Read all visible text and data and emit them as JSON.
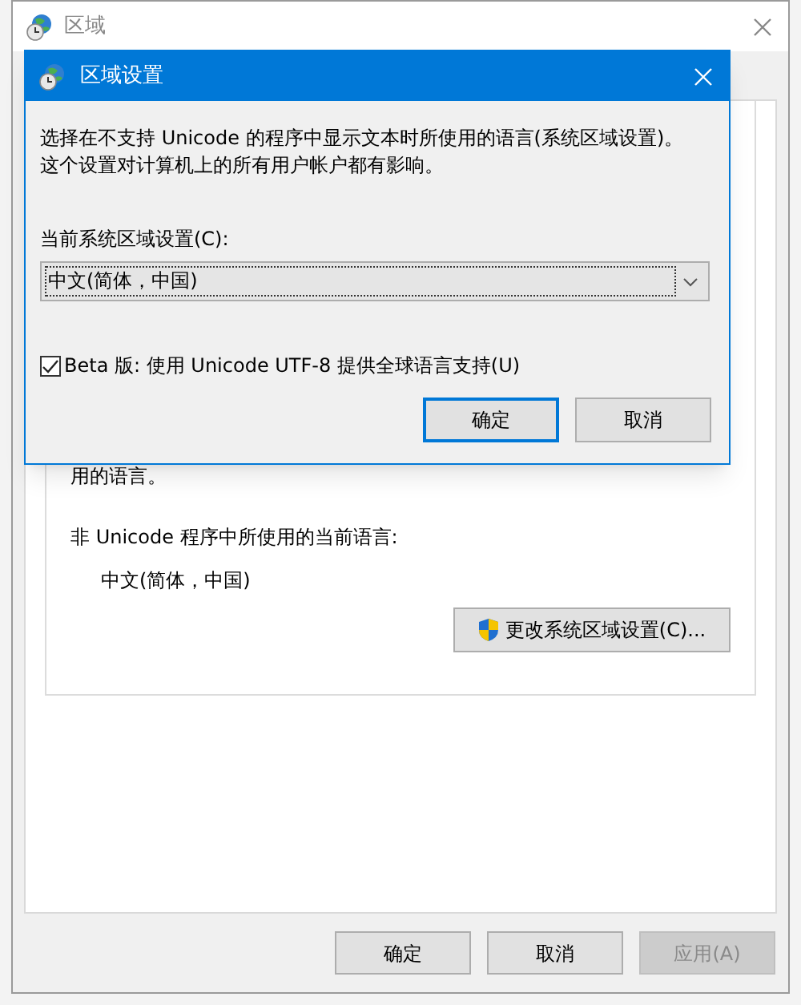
{
  "window": {
    "title": "区域"
  },
  "panel": {
    "text_top": "用的语言。",
    "current_label": "非 Unicode 程序中所使用的当前语言:",
    "current_value": "中文(简体，中国)",
    "change_button": "更改系统区域设置(C)..."
  },
  "buttons": [
    {
      "label": "确定",
      "disabled": false
    },
    {
      "label": "取消",
      "disabled": false
    },
    {
      "label": "应用(A)",
      "disabled": true
    }
  ],
  "dialog": {
    "title": "区域设置",
    "description": "选择在不支持 Unicode 的程序中显示文本时所使用的语言(系统区域设置)。这个设置对计算机上的所有用户帐户都有影响。",
    "locale_label": "当前系统区域设置(C):",
    "locale_value": "中文(简体，中国)",
    "beta": {
      "label": "Beta 版: 使用 Unicode UTF-8 提供全球语言支持(U)",
      "checked": true
    },
    "buttons": [
      {
        "label": "确定",
        "default": true
      },
      {
        "label": "取消",
        "default": false
      }
    ]
  }
}
